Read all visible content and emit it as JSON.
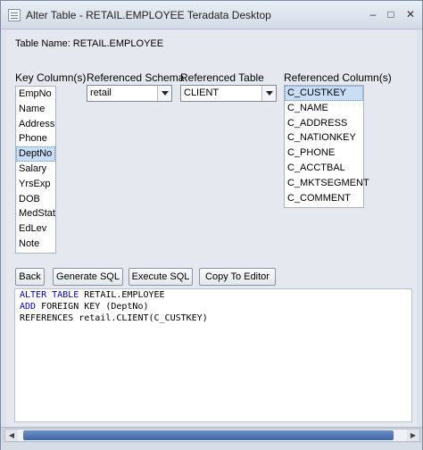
{
  "window": {
    "title": "Alter Table - RETAIL.EMPLOYEE Teradata Desktop"
  },
  "table_name": "Table Name: RETAIL.EMPLOYEE",
  "headers": {
    "key_columns": "Key Column(s)",
    "referenced_schema": "Referenced Schema",
    "referenced_table": "Referenced Table",
    "referenced_columns": "Referenced Column(s)"
  },
  "key_columns": [
    "EmpNo",
    "Name",
    "Address",
    "Phone",
    "DeptNo",
    "Salary",
    "YrsExp",
    "DOB",
    "MedStat",
    "EdLev",
    "Note"
  ],
  "key_columns_selected": "DeptNo",
  "schema_select": {
    "value": "retail"
  },
  "table_select": {
    "value": "CLIENT"
  },
  "referenced_columns": [
    "C_CUSTKEY",
    "C_NAME",
    "C_ADDRESS",
    "C_NATIONKEY",
    "C_PHONE",
    "C_ACCTBAL",
    "C_MKTSEGMENT",
    "C_COMMENT"
  ],
  "referenced_columns_selected": "C_CUSTKEY",
  "buttons": {
    "back": "Back",
    "generate_sql": "Generate SQL",
    "execute_sql": "Execute SQL",
    "copy_to_editor": "Copy To Editor"
  },
  "sql": {
    "line1_kw": "ALTER TABLE",
    "line1_rest": " RETAIL.EMPLOYEE",
    "line2_kw": "ADD",
    "line2_rest": " FOREIGN KEY (DeptNo)",
    "line3": "REFERENCES retail.CLIENT(C_CUSTKEY)"
  },
  "icons": {
    "window": "window-icon",
    "minimize": "minimize-icon",
    "maximize": "maximize-icon",
    "close": "close-icon",
    "dropdown": "chevron-down-icon"
  }
}
